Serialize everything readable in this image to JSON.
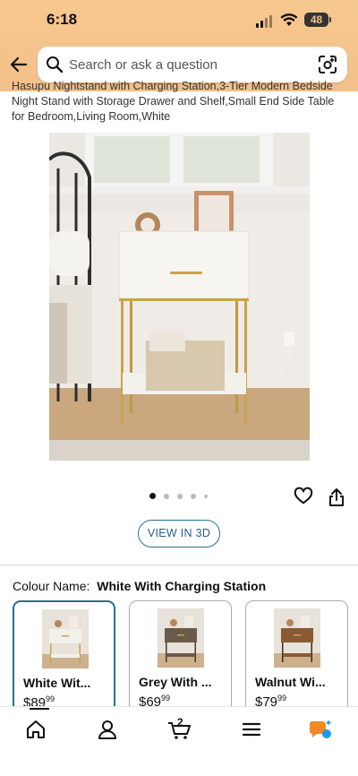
{
  "status_bar": {
    "time": "6:18",
    "battery": "48"
  },
  "search": {
    "placeholder": "Search or ask a question"
  },
  "product": {
    "title": "Hasupu Nightstand with Charging Station,3-Tier Modern Bedside Night Stand with Storage Drawer and Shelf,Small End Side Table for Bedroom,Living Room,White",
    "view_3d": "VIEW IN 3D",
    "colour_label": "Colour Name:",
    "colour_selected": "White With Charging Station",
    "swatches": [
      {
        "name": "White Wit...",
        "price_main": "$89",
        "price_cents": "99",
        "selected": true,
        "body_color": "#f3f0ea",
        "leg_color": "#c8a44a"
      },
      {
        "name": "Grey With ...",
        "price_main": "$69",
        "price_cents": "99",
        "selected": false,
        "body_color": "#6a5a4c",
        "leg_color": "#4a3a2e"
      },
      {
        "name": "Walnut Wi...",
        "price_main": "$79",
        "price_cents": "99",
        "selected": false,
        "body_color": "#8a5a34",
        "leg_color": "#3b2a1e"
      }
    ]
  },
  "carousel": {
    "count": 5,
    "active": 0
  },
  "tabs": [
    "home-icon",
    "account-icon",
    "cart-icon",
    "menu-icon",
    "rufus-icon"
  ],
  "cart_count": "2",
  "colors": {
    "header": "#f3c089",
    "accent": "#2a6f8f"
  }
}
